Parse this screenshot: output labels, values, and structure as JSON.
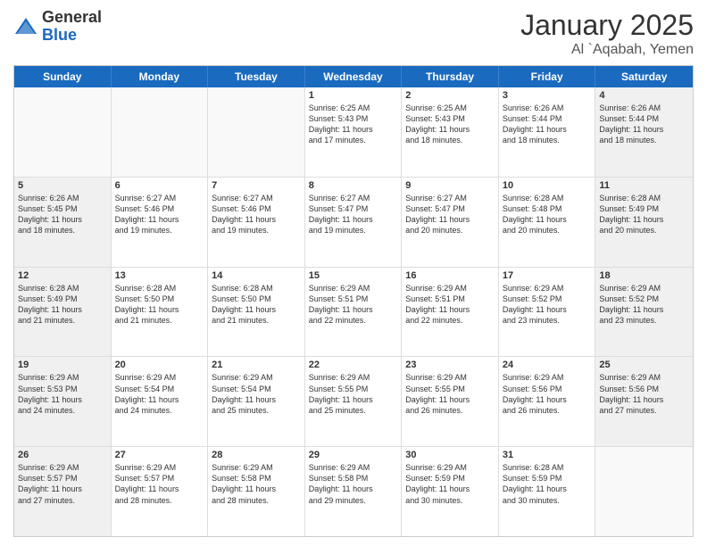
{
  "logo": {
    "general": "General",
    "blue": "Blue"
  },
  "title": {
    "month": "January 2025",
    "location": "Al `Aqabah, Yemen"
  },
  "header_days": [
    "Sunday",
    "Monday",
    "Tuesday",
    "Wednesday",
    "Thursday",
    "Friday",
    "Saturday"
  ],
  "rows": [
    [
      {
        "day": "",
        "lines": [],
        "empty": true
      },
      {
        "day": "",
        "lines": [],
        "empty": true
      },
      {
        "day": "",
        "lines": [],
        "empty": true
      },
      {
        "day": "1",
        "lines": [
          "Sunrise: 6:25 AM",
          "Sunset: 5:43 PM",
          "Daylight: 11 hours",
          "and 17 minutes."
        ],
        "empty": false
      },
      {
        "day": "2",
        "lines": [
          "Sunrise: 6:25 AM",
          "Sunset: 5:43 PM",
          "Daylight: 11 hours",
          "and 18 minutes."
        ],
        "empty": false
      },
      {
        "day": "3",
        "lines": [
          "Sunrise: 6:26 AM",
          "Sunset: 5:44 PM",
          "Daylight: 11 hours",
          "and 18 minutes."
        ],
        "empty": false
      },
      {
        "day": "4",
        "lines": [
          "Sunrise: 6:26 AM",
          "Sunset: 5:44 PM",
          "Daylight: 11 hours",
          "and 18 minutes."
        ],
        "empty": false
      }
    ],
    [
      {
        "day": "5",
        "lines": [
          "Sunrise: 6:26 AM",
          "Sunset: 5:45 PM",
          "Daylight: 11 hours",
          "and 18 minutes."
        ],
        "empty": false
      },
      {
        "day": "6",
        "lines": [
          "Sunrise: 6:27 AM",
          "Sunset: 5:46 PM",
          "Daylight: 11 hours",
          "and 19 minutes."
        ],
        "empty": false
      },
      {
        "day": "7",
        "lines": [
          "Sunrise: 6:27 AM",
          "Sunset: 5:46 PM",
          "Daylight: 11 hours",
          "and 19 minutes."
        ],
        "empty": false
      },
      {
        "day": "8",
        "lines": [
          "Sunrise: 6:27 AM",
          "Sunset: 5:47 PM",
          "Daylight: 11 hours",
          "and 19 minutes."
        ],
        "empty": false
      },
      {
        "day": "9",
        "lines": [
          "Sunrise: 6:27 AM",
          "Sunset: 5:47 PM",
          "Daylight: 11 hours",
          "and 20 minutes."
        ],
        "empty": false
      },
      {
        "day": "10",
        "lines": [
          "Sunrise: 6:28 AM",
          "Sunset: 5:48 PM",
          "Daylight: 11 hours",
          "and 20 minutes."
        ],
        "empty": false
      },
      {
        "day": "11",
        "lines": [
          "Sunrise: 6:28 AM",
          "Sunset: 5:49 PM",
          "Daylight: 11 hours",
          "and 20 minutes."
        ],
        "empty": false
      }
    ],
    [
      {
        "day": "12",
        "lines": [
          "Sunrise: 6:28 AM",
          "Sunset: 5:49 PM",
          "Daylight: 11 hours",
          "and 21 minutes."
        ],
        "empty": false
      },
      {
        "day": "13",
        "lines": [
          "Sunrise: 6:28 AM",
          "Sunset: 5:50 PM",
          "Daylight: 11 hours",
          "and 21 minutes."
        ],
        "empty": false
      },
      {
        "day": "14",
        "lines": [
          "Sunrise: 6:28 AM",
          "Sunset: 5:50 PM",
          "Daylight: 11 hours",
          "and 21 minutes."
        ],
        "empty": false
      },
      {
        "day": "15",
        "lines": [
          "Sunrise: 6:29 AM",
          "Sunset: 5:51 PM",
          "Daylight: 11 hours",
          "and 22 minutes."
        ],
        "empty": false
      },
      {
        "day": "16",
        "lines": [
          "Sunrise: 6:29 AM",
          "Sunset: 5:51 PM",
          "Daylight: 11 hours",
          "and 22 minutes."
        ],
        "empty": false
      },
      {
        "day": "17",
        "lines": [
          "Sunrise: 6:29 AM",
          "Sunset: 5:52 PM",
          "Daylight: 11 hours",
          "and 23 minutes."
        ],
        "empty": false
      },
      {
        "day": "18",
        "lines": [
          "Sunrise: 6:29 AM",
          "Sunset: 5:52 PM",
          "Daylight: 11 hours",
          "and 23 minutes."
        ],
        "empty": false
      }
    ],
    [
      {
        "day": "19",
        "lines": [
          "Sunrise: 6:29 AM",
          "Sunset: 5:53 PM",
          "Daylight: 11 hours",
          "and 24 minutes."
        ],
        "empty": false
      },
      {
        "day": "20",
        "lines": [
          "Sunrise: 6:29 AM",
          "Sunset: 5:54 PM",
          "Daylight: 11 hours",
          "and 24 minutes."
        ],
        "empty": false
      },
      {
        "day": "21",
        "lines": [
          "Sunrise: 6:29 AM",
          "Sunset: 5:54 PM",
          "Daylight: 11 hours",
          "and 25 minutes."
        ],
        "empty": false
      },
      {
        "day": "22",
        "lines": [
          "Sunrise: 6:29 AM",
          "Sunset: 5:55 PM",
          "Daylight: 11 hours",
          "and 25 minutes."
        ],
        "empty": false
      },
      {
        "day": "23",
        "lines": [
          "Sunrise: 6:29 AM",
          "Sunset: 5:55 PM",
          "Daylight: 11 hours",
          "and 26 minutes."
        ],
        "empty": false
      },
      {
        "day": "24",
        "lines": [
          "Sunrise: 6:29 AM",
          "Sunset: 5:56 PM",
          "Daylight: 11 hours",
          "and 26 minutes."
        ],
        "empty": false
      },
      {
        "day": "25",
        "lines": [
          "Sunrise: 6:29 AM",
          "Sunset: 5:56 PM",
          "Daylight: 11 hours",
          "and 27 minutes."
        ],
        "empty": false
      }
    ],
    [
      {
        "day": "26",
        "lines": [
          "Sunrise: 6:29 AM",
          "Sunset: 5:57 PM",
          "Daylight: 11 hours",
          "and 27 minutes."
        ],
        "empty": false
      },
      {
        "day": "27",
        "lines": [
          "Sunrise: 6:29 AM",
          "Sunset: 5:57 PM",
          "Daylight: 11 hours",
          "and 28 minutes."
        ],
        "empty": false
      },
      {
        "day": "28",
        "lines": [
          "Sunrise: 6:29 AM",
          "Sunset: 5:58 PM",
          "Daylight: 11 hours",
          "and 28 minutes."
        ],
        "empty": false
      },
      {
        "day": "29",
        "lines": [
          "Sunrise: 6:29 AM",
          "Sunset: 5:58 PM",
          "Daylight: 11 hours",
          "and 29 minutes."
        ],
        "empty": false
      },
      {
        "day": "30",
        "lines": [
          "Sunrise: 6:29 AM",
          "Sunset: 5:59 PM",
          "Daylight: 11 hours",
          "and 30 minutes."
        ],
        "empty": false
      },
      {
        "day": "31",
        "lines": [
          "Sunrise: 6:28 AM",
          "Sunset: 5:59 PM",
          "Daylight: 11 hours",
          "and 30 minutes."
        ],
        "empty": false
      },
      {
        "day": "",
        "lines": [],
        "empty": true
      }
    ]
  ]
}
